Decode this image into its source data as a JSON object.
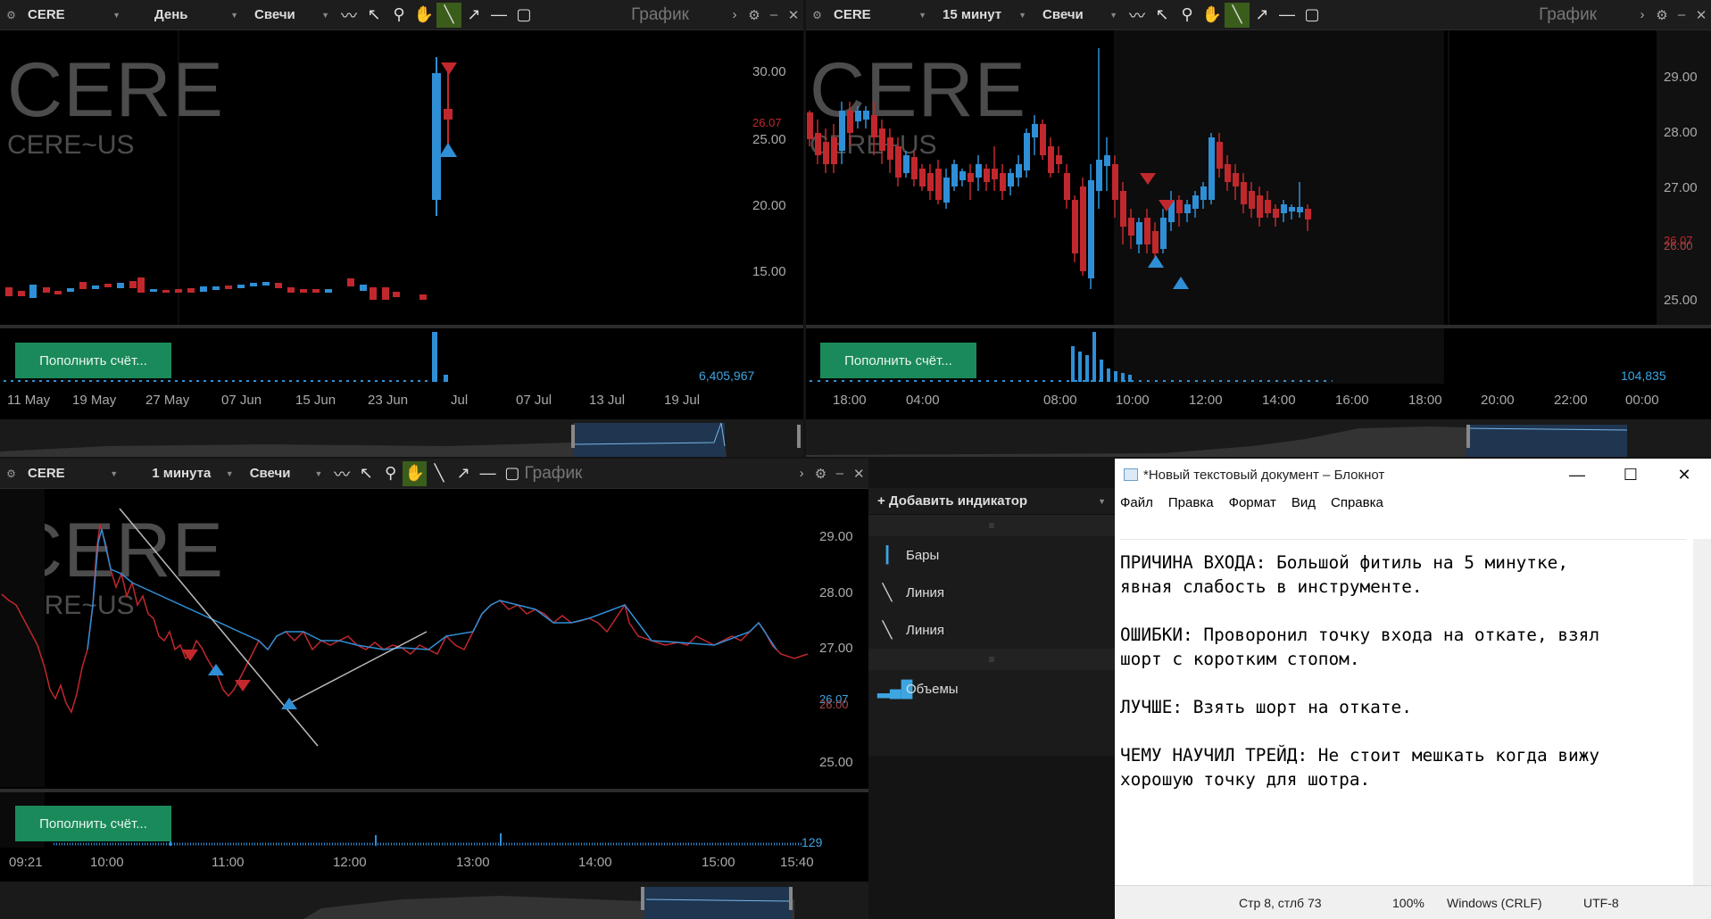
{
  "colors": {
    "up": "#2f8fd6",
    "down": "#c1282d",
    "accent": "#1b8a5a",
    "active_tool": "#3b5d1b"
  },
  "toolbar_icons": [
    "compare-icon",
    "cursor-icon",
    "zoom-icon",
    "hand-icon",
    "trendline-icon",
    "arrow-icon",
    "hline-icon",
    "rectangle-icon"
  ],
  "chart1": {
    "symbol": "CERE",
    "period": "День",
    "type": "Свечи",
    "title": "График",
    "wm_ticker": "CERE",
    "wm_full": "CERE~US",
    "price_ticks": [
      "30.00",
      "25.00",
      "20.00",
      "15.00"
    ],
    "last_price": "26.07",
    "deposit": "Пополнить счёт...",
    "volume": "6,405,967",
    "x_labels": [
      "11 May",
      "19 May",
      "27 May",
      "07 Jun",
      "15 Jun",
      "23 Jun",
      "Jul",
      "07 Jul",
      "13 Jul",
      "19 Jul"
    ]
  },
  "chart2": {
    "symbol": "CERE",
    "period": "15 минут",
    "type": "Свечи",
    "title": "График",
    "wm_ticker": "CERE",
    "wm_full": "CERE~US",
    "price_ticks": [
      "29.00",
      "28.00",
      "27.00",
      "25.00"
    ],
    "last_price": "26.07",
    "last_price2": "26.00",
    "deposit": "Пополнить счёт...",
    "volume": "104,835",
    "x_labels": [
      "18:00",
      "04:00",
      "08:00",
      "10:00",
      "12:00",
      "14:00",
      "16:00",
      "18:00",
      "20:00",
      "22:00",
      "00:00"
    ]
  },
  "chart3": {
    "symbol": "CERE",
    "period": "1 минута",
    "type": "Свечи",
    "title": "График",
    "wm_ticker": "CERE",
    "wm_full": "CERE~US",
    "price_ticks": [
      "29.00",
      "28.00",
      "27.00",
      "25.00"
    ],
    "last_price": "26.07",
    "last_price2": "26.00",
    "deposit": "Пополнить счёт...",
    "volume": "129",
    "x_labels": [
      "09:21",
      "10:00",
      "11:00",
      "12:00",
      "13:00",
      "14:00",
      "15:00",
      "15:40"
    ]
  },
  "indicators": {
    "add_label": "+ Добавить индикатор",
    "items": [
      "Бары",
      "Линия",
      "Линия",
      "Объемы"
    ]
  },
  "notepad": {
    "title": "*Новый текстовый документ – Блокнот",
    "menu": [
      "Файл",
      "Правка",
      "Формат",
      "Вид",
      "Справка"
    ],
    "text": "ПРИЧИНА ВХОДА: Большой фитиль на 5 минутке,\nявная слабость в инструменте.\n\nОШИБКИ: Проворонил точку входа на откате, взял\nшорт с коротким стопом.\n\nЛУЧШЕ: Взять шорт на откате.\n\nЧЕМУ НАУЧИЛ ТРЕЙД: Не стоит мешкать когда вижу\nхорошую точку для шотра. ",
    "status_pos": "Стр 8, стлб 73",
    "status_zoom": "100%",
    "status_eol": "Windows (CRLF)",
    "status_enc": "UTF-8"
  }
}
